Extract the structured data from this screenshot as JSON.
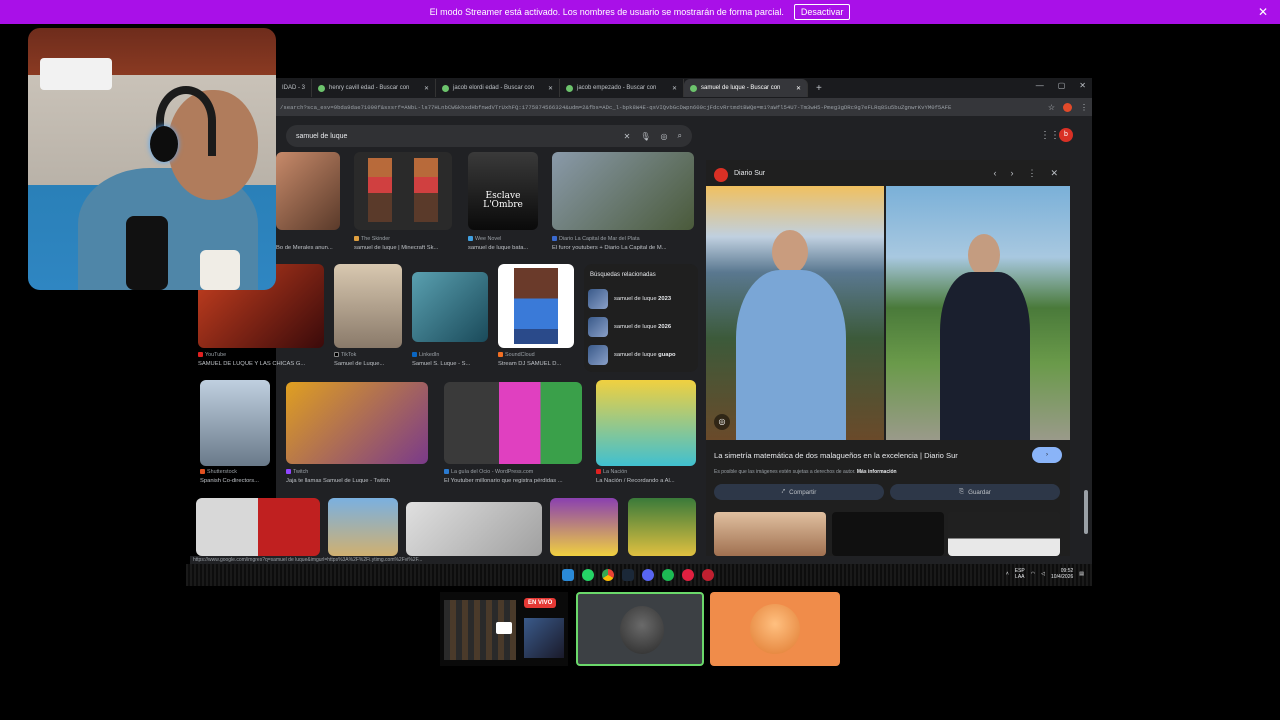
{
  "banner": {
    "text": "El modo Streamer está activado. Los nombres de usuario se mostrarán de forma parcial.",
    "button": "Desactivar",
    "close": "✕"
  },
  "browser": {
    "tabs": [
      {
        "label": "IDAD - 3"
      },
      {
        "label": "henry cavill edad - Buscar con"
      },
      {
        "label": "jacob elordi edad - Buscar con"
      },
      {
        "label": "jacob empezado - Buscar con"
      },
      {
        "label": "samuel de luque - Buscar con"
      }
    ],
    "new_tab": "+",
    "url": "/search?sca_esv=9bda9dae71090f&sxsrf=ANbL-ls77HLnbCWGkhxdHbfnwdVTrUxhFQ:1775874566324&udm=2&fbs=ADc_l-bpk8W4E-qsVIQvbGcDwpn600cjFdcvRrtmdtBWQe=m1?aWfl54U7-Tm3wH5-Pmeg3gDRc9g7eFLRq8Su5buZgnwrKvYM0f5AFE",
    "search_query": "samuel de luque",
    "profile_letter": "b"
  },
  "results": {
    "row1": [
      {
        "source": "",
        "title": "Bo de Merales anun..."
      },
      {
        "source": "The Skinder",
        "title": "samuel de luque | Minecraft Sk..."
      },
      {
        "source": "Wee Novel",
        "title": "samuel de luque bata..."
      },
      {
        "source": "Diario La Capital de Mar del Plata",
        "title": "El furor youtubers + Diario La Capital de M..."
      }
    ],
    "row2": [
      {
        "source": "YouTube",
        "title": "SAMUEL DE LUQUE Y LAS CHICAS G..."
      },
      {
        "source": "TikTok",
        "title": "Samuel de Luque..."
      },
      {
        "source": "LinkedIn",
        "title": "Samuel S. Luque - S..."
      },
      {
        "source": "SoundCloud",
        "title": "Stream DJ SAMUEL D..."
      }
    ],
    "related": {
      "title": "Búsquedas relacionadas",
      "items": [
        {
          "base": "samuel de luque",
          "bold": "2023"
        },
        {
          "base": "samuel de luque",
          "bold": "2026"
        },
        {
          "base": "samuel de luque",
          "bold": "guapo"
        }
      ]
    },
    "row3": [
      {
        "source": "Shutterstock",
        "title": "Spanish Co-directors..."
      },
      {
        "source": "Twitch",
        "title": "Jaja te llamas Samuel de Luque - Twitch"
      },
      {
        "source": "La guía del Ocio - WordPress.com",
        "title": "El Youtuber millonario que registra pérdidas ..."
      },
      {
        "source": "La Nación",
        "title": "La Nación / Recordando a Al..."
      }
    ]
  },
  "preview": {
    "source": "Diario Sur",
    "title": "La simetría matemática de dos malagueños en la excelencia | Diario Sur",
    "visit": "›",
    "note": "Es posible que las imágenes estén sujetas a derechos de autor.",
    "note_link": "Más información",
    "share": "Compartir",
    "save": "Guardar"
  },
  "status_url": "https://www.google.com/imgres?q=samuel de luque&imgurl=https%3A%2F%2Fi.ytimg.com%2Fvi%2F...",
  "taskbar": {
    "lang_top": "ESP",
    "lang_bottom": "LAA",
    "time": "09:52",
    "date": "10/4/2026"
  },
  "live_badge": "EN VIVO",
  "colors": {
    "banner": "#a910e8",
    "live": "#e53935",
    "speaking_border": "#6bd96b",
    "card3": "#f08c4a"
  }
}
